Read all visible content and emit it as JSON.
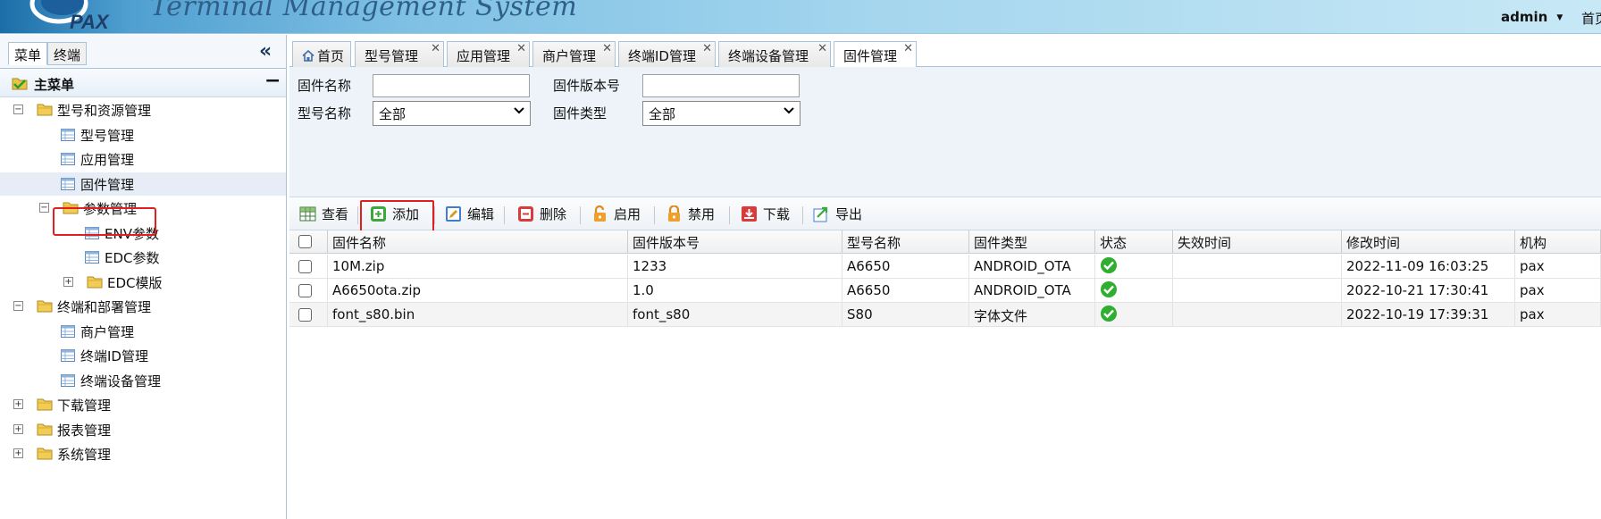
{
  "header": {
    "logo_text": "PAX",
    "system_title": "Terminal Management System",
    "user": "admin",
    "home_link": "首页"
  },
  "left_panel": {
    "tabs": [
      "菜单",
      "终端"
    ],
    "menu_title": "主菜单",
    "tree": [
      {
        "label": "型号和资源管理",
        "type": "folder",
        "level": 0,
        "toggle": "−"
      },
      {
        "label": "型号管理",
        "type": "page",
        "level": 1
      },
      {
        "label": "应用管理",
        "type": "page",
        "level": 1
      },
      {
        "label": "固件管理",
        "type": "page",
        "level": 1,
        "selected": true
      },
      {
        "label": "参数管理",
        "type": "folder",
        "level": 1,
        "toggle": "−"
      },
      {
        "label": "ENV参数",
        "type": "page",
        "level": 2
      },
      {
        "label": "EDC参数",
        "type": "page",
        "level": 2
      },
      {
        "label": "EDC模版",
        "type": "folder",
        "level": 2,
        "toggle": "+"
      },
      {
        "label": "终端和部署管理",
        "type": "folder",
        "level": 0,
        "toggle": "−"
      },
      {
        "label": "商户管理",
        "type": "page",
        "level": 1
      },
      {
        "label": "终端ID管理",
        "type": "page",
        "level": 1
      },
      {
        "label": "终端设备管理",
        "type": "page",
        "level": 1
      },
      {
        "label": "下载管理",
        "type": "folder",
        "level": 0,
        "toggle": "+"
      },
      {
        "label": "报表管理",
        "type": "folder",
        "level": 0,
        "toggle": "+"
      },
      {
        "label": "系统管理",
        "type": "folder",
        "level": 0,
        "toggle": "+"
      }
    ]
  },
  "tabs": [
    {
      "label": "首页",
      "closable": false
    },
    {
      "label": "型号管理",
      "closable": true
    },
    {
      "label": "应用管理",
      "closable": true
    },
    {
      "label": "商户管理",
      "closable": true
    },
    {
      "label": "终端ID管理",
      "closable": true
    },
    {
      "label": "终端设备管理",
      "closable": true
    },
    {
      "label": "固件管理",
      "closable": true,
      "active": true
    }
  ],
  "filter": {
    "firmware_name_label": "固件名称",
    "firmware_name_value": "",
    "firmware_version_label": "固件版本号",
    "firmware_version_value": "",
    "model_name_label": "型号名称",
    "model_name_value": "全部",
    "firmware_type_label": "固件类型",
    "firmware_type_value": "全部"
  },
  "toolbar": {
    "view": "查看",
    "add": "添加",
    "edit": "编辑",
    "delete": "删除",
    "enable": "启用",
    "disable": "禁用",
    "download": "下载",
    "export": "导出"
  },
  "grid": {
    "columns": [
      "固件名称",
      "固件版本号",
      "型号名称",
      "固件类型",
      "状态",
      "失效时间",
      "修改时间",
      "机构"
    ],
    "rows": [
      {
        "name": "10M.zip",
        "version": "1233",
        "model": "A6650",
        "type": "ANDROID_OTA",
        "status": "enabled",
        "expire": "",
        "modified": "2022-11-09 16:03:25",
        "org": "pax"
      },
      {
        "name": "A6650ota.zip",
        "version": "1.0",
        "model": "A6650",
        "type": "ANDROID_OTA",
        "status": "enabled",
        "expire": "",
        "modified": "2022-10-21 17:30:41",
        "org": "pax"
      },
      {
        "name": "font_s80.bin",
        "version": "font_s80",
        "model": "S80",
        "type": "字体文件",
        "status": "enabled",
        "expire": "",
        "modified": "2022-10-19 17:39:31",
        "org": "pax"
      }
    ]
  },
  "colors": {
    "highlight": "#e02020",
    "header_blue": "#7ec0e4",
    "status_green": "#2fae2f"
  }
}
